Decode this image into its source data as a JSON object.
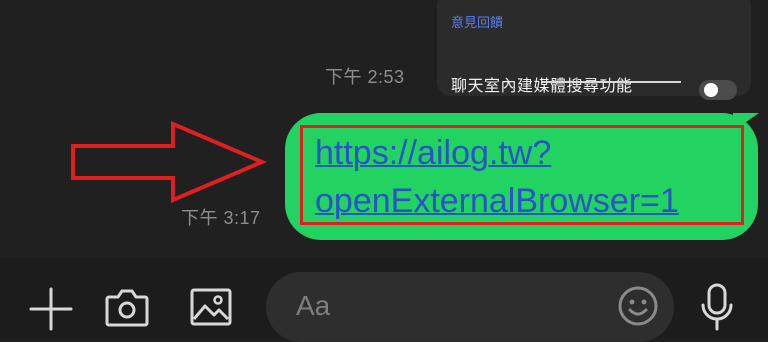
{
  "popover": {
    "feedback_label": "意見回饋",
    "feature_label": "聊天室內建媒體搜尋功能",
    "toggle_on": false
  },
  "messages": [
    {
      "timestamp": "下午 2:53"
    },
    {
      "timestamp": "下午 3:17",
      "text": "https://ailog.tw?\nopenExternalBrowser=1",
      "highlight_color": "#e02020",
      "bubble_color": "#23d361"
    }
  ],
  "composer": {
    "placeholder": "Aa",
    "icons": [
      "plus-icon",
      "camera-icon",
      "image-icon",
      "emoji-icon",
      "mic-icon"
    ]
  },
  "colors": {
    "accent": "#23d361",
    "link": "#2a52c9",
    "annotation": "#e02020"
  }
}
